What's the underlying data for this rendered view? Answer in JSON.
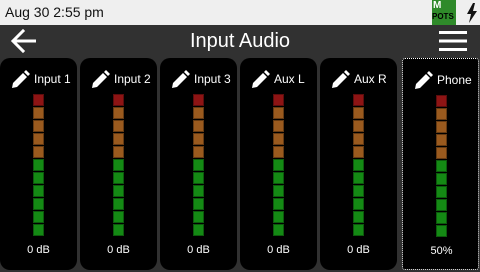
{
  "status": {
    "time": "Aug 30 2:55 pm",
    "badge_top": "M",
    "badge_bottom": "POTS"
  },
  "header": {
    "title": "Input Audio",
    "back_icon": "back-arrow-icon",
    "menu_icon": "hamburger-menu-icon"
  },
  "meter_colors": {
    "red": "#8e1414",
    "orange": "#9a5a1e",
    "green": "#148a14"
  },
  "meter_segments": [
    "red",
    "orange",
    "orange",
    "orange",
    "orange",
    "green",
    "green",
    "green",
    "green",
    "green",
    "green"
  ],
  "channels": [
    {
      "label": "Input 1",
      "value": "0 dB",
      "selected": false
    },
    {
      "label": "Input 2",
      "value": "0 dB",
      "selected": false
    },
    {
      "label": "Input 3",
      "value": "0 dB",
      "selected": false
    },
    {
      "label": "Aux L",
      "value": "0 dB",
      "selected": false
    },
    {
      "label": "Aux R",
      "value": "0 dB",
      "selected": false
    },
    {
      "label": "Phone",
      "value": "50%",
      "selected": true
    }
  ]
}
